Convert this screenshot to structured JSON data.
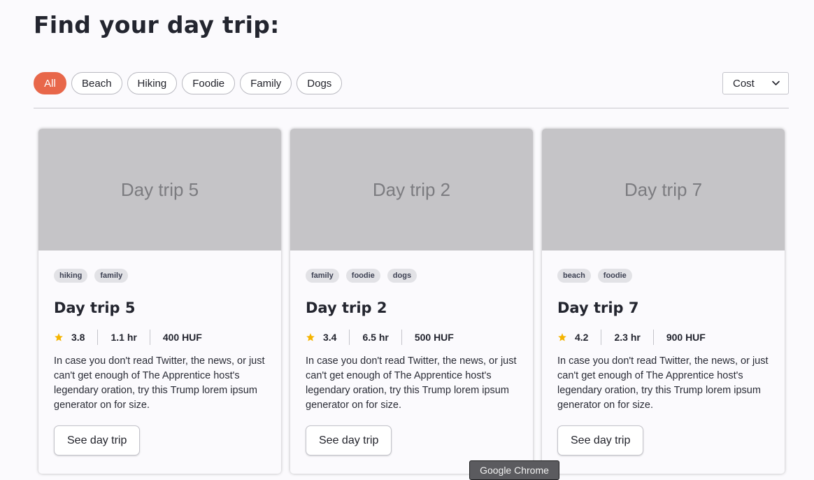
{
  "page": {
    "title": "Find your day trip:"
  },
  "filters": {
    "items": [
      {
        "label": "All",
        "active": true
      },
      {
        "label": "Beach",
        "active": false
      },
      {
        "label": "Hiking",
        "active": false
      },
      {
        "label": "Foodie",
        "active": false
      },
      {
        "label": "Family",
        "active": false
      },
      {
        "label": "Dogs",
        "active": false
      }
    ]
  },
  "sort": {
    "selected": "Cost",
    "icon": "chevron-down-icon"
  },
  "colors": {
    "accent": "#e8674a",
    "star": "#f5b400",
    "image_placeholder": "#c5c4c7"
  },
  "cards": [
    {
      "image_label": "Day trip 5",
      "tags": [
        "hiking",
        "family"
      ],
      "title": "Day trip 5",
      "rating": "3.8",
      "duration": "1.1 hr",
      "cost": "400 HUF",
      "description": "In case you don't read Twitter, the news, or just can't get enough of The Apprentice host's legendary oration, try this Trump lorem ipsum generator on for size.",
      "button_label": "See day trip"
    },
    {
      "image_label": "Day trip 2",
      "tags": [
        "family",
        "foodie",
        "dogs"
      ],
      "title": "Day trip 2",
      "rating": "3.4",
      "duration": "6.5 hr",
      "cost": "500 HUF",
      "description": "In case you don't read Twitter, the news, or just can't get enough of The Apprentice host's legendary oration, try this Trump lorem ipsum generator on for size.",
      "button_label": "See day trip"
    },
    {
      "image_label": "Day trip 7",
      "tags": [
        "beach",
        "foodie"
      ],
      "title": "Day trip 7",
      "rating": "4.2",
      "duration": "2.3 hr",
      "cost": "900 HUF",
      "description": "In case you don't read Twitter, the news, or just can't get enough of The Apprentice host's legendary oration, try this Trump lorem ipsum generator on for size.",
      "button_label": "See day trip"
    }
  ],
  "tooltip": {
    "text": "Google Chrome"
  }
}
